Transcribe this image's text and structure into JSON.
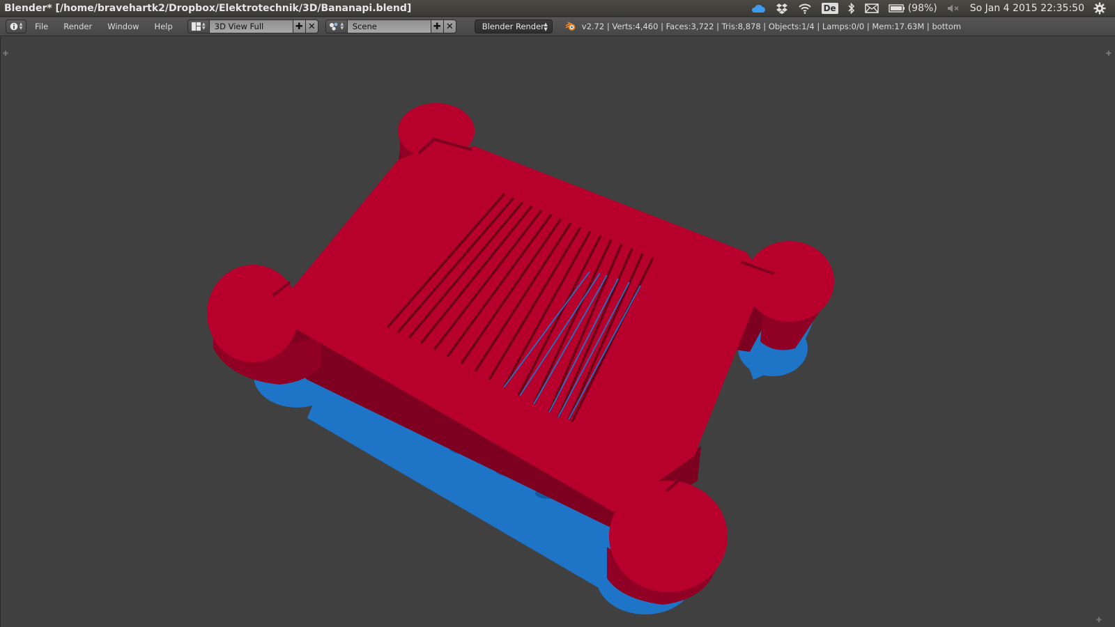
{
  "titlebar": {
    "title": "Blender* [/home/bravehartk2/Dropbox/Elektrotechnik/3D/Bananapi.blend]",
    "keyboard_layout": "De",
    "battery": "(98%)",
    "clock": "So Jan  4 2015 22:35:50",
    "icons": [
      "cloud-icon",
      "dropbox-icon",
      "wifi-icon",
      "keyboard-layout-icon",
      "bluetooth-icon",
      "mail-icon",
      "battery-icon",
      "volume-muted-icon",
      "settings-gear-icon"
    ]
  },
  "header": {
    "editor_type_icon": "info-icon",
    "menus": [
      "File",
      "Render",
      "Window",
      "Help"
    ],
    "screen_layout": {
      "icon": "screen-layout-icon",
      "value": "3D View Full"
    },
    "scene": {
      "icon": "scene-icon",
      "value": "Scene"
    },
    "render_engine": "Blender Render",
    "stats": "v2.72 | Verts:4,460 | Faces:3,722 | Tris:8,878 | Objects:1/4 | Lamps:0/0 | Mem:17.63M | bottom"
  },
  "viewport": {
    "view_name": "bottom",
    "colors": {
      "background": "#404040",
      "red_object": "#b8002c",
      "red_shadow": "#7e0020",
      "blue_object": "#1e74c6"
    }
  }
}
